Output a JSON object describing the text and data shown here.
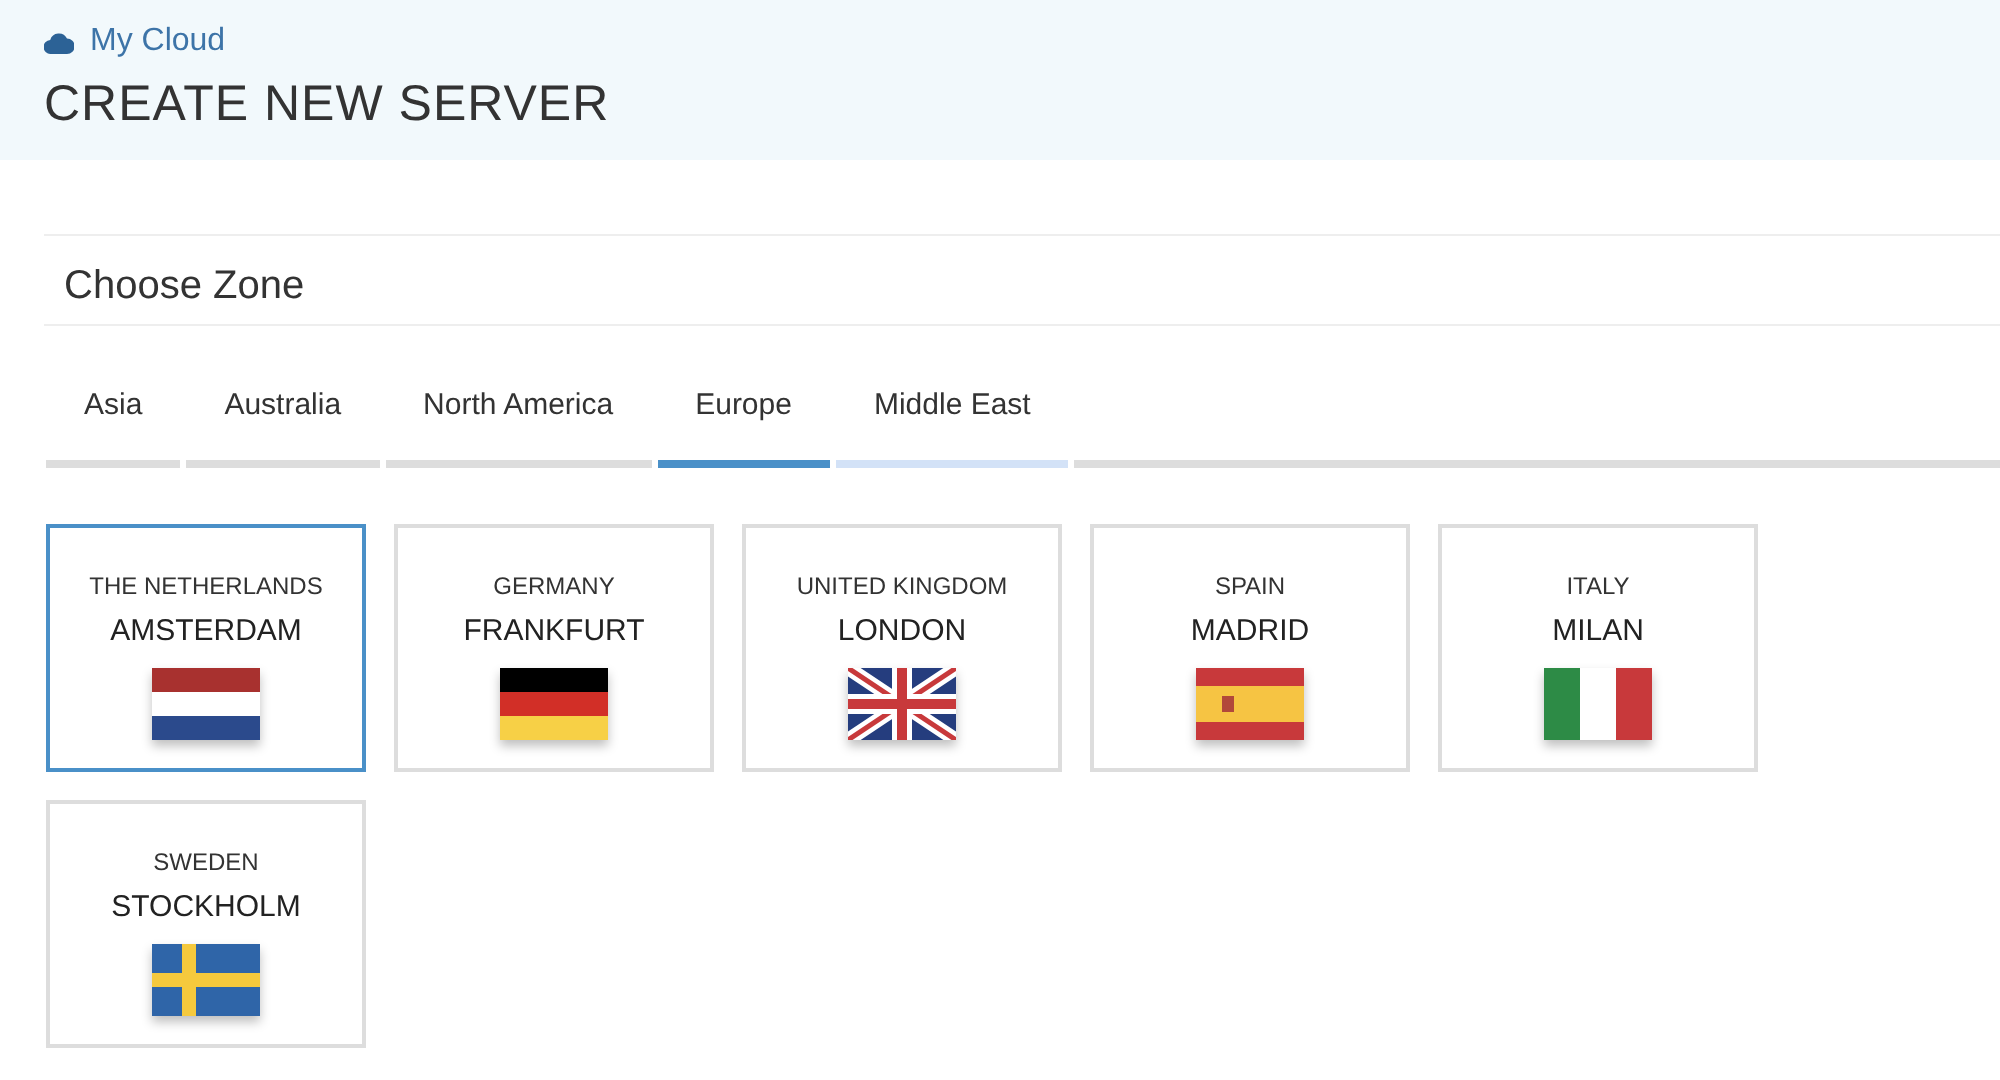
{
  "breadcrumb": "My Cloud",
  "title": "CREATE NEW SERVER",
  "section_title": "Choose Zone",
  "tabs": [
    {
      "label": "Asia",
      "selected": false,
      "hovered": false
    },
    {
      "label": "Australia",
      "selected": false,
      "hovered": false
    },
    {
      "label": "North America",
      "selected": false,
      "hovered": false
    },
    {
      "label": "Europe",
      "selected": true,
      "hovered": false
    },
    {
      "label": "Middle East",
      "selected": false,
      "hovered": true
    }
  ],
  "zones": [
    {
      "country": "THE NETHERLANDS",
      "city": "AMSTERDAM",
      "kind": "nl",
      "selected": true
    },
    {
      "country": "GERMANY",
      "city": "FRANKFURT",
      "kind": "de",
      "selected": false
    },
    {
      "country": "UNITED KINGDOM",
      "city": "LONDON",
      "kind": "gb",
      "selected": false
    },
    {
      "country": "SPAIN",
      "city": "MADRID",
      "kind": "es",
      "selected": false
    },
    {
      "country": "ITALY",
      "city": "MILAN",
      "kind": "it",
      "selected": false
    },
    {
      "country": "SWEDEN",
      "city": "STOCKHOLM",
      "kind": "se",
      "selected": false
    }
  ]
}
